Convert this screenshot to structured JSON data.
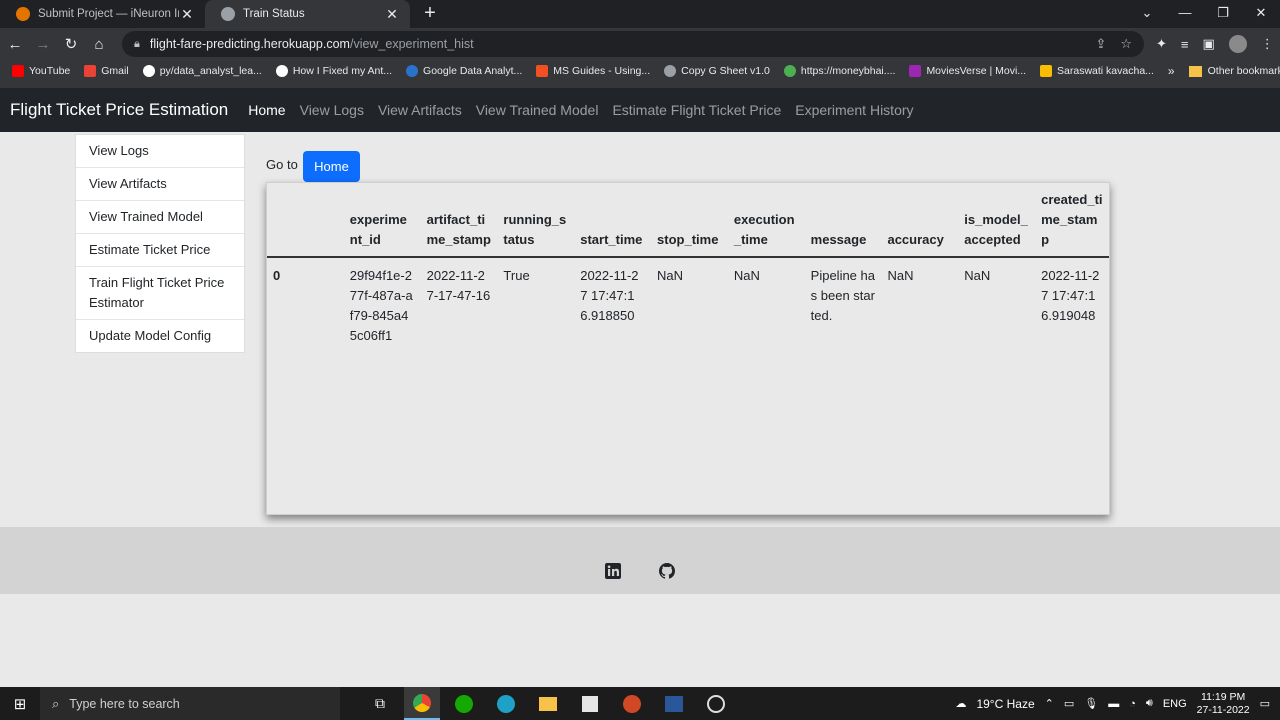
{
  "browser": {
    "tabs": [
      {
        "title": "Submit Project — iNeuron Intern",
        "close": "✕",
        "favicon_color": "#e37400"
      },
      {
        "title": "Train Status",
        "close": "✕",
        "favicon_color": "#9aa0a6"
      }
    ],
    "new_tab": "+",
    "address": {
      "host": "flight-fare-predicting.herokuapp.com",
      "path": "/view_experiment_hist"
    },
    "bookmarks": [
      {
        "label": "YouTube",
        "icon": "youtube-icon",
        "color": "#ff0000"
      },
      {
        "label": "Gmail",
        "icon": "gmail-icon",
        "color": "#ea4335"
      },
      {
        "label": "py/data_analyst_lea...",
        "icon": "github-icon",
        "color": "#ffffff"
      },
      {
        "label": "How I Fixed my Ant...",
        "icon": "medium-icon",
        "color": "#ffffff"
      },
      {
        "label": "Google Data Analyt...",
        "icon": "coursera-icon",
        "color": "#2a73cc"
      },
      {
        "label": "MS Guides - Using...",
        "icon": "ms-icon",
        "color": "#f25022"
      },
      {
        "label": "Copy G Sheet v1.0",
        "icon": "globe-icon",
        "color": "#9aa0a6"
      },
      {
        "label": "https://moneybhai....",
        "icon": "money-icon",
        "color": "#4caf50"
      },
      {
        "label": "MoviesVerse | Movi...",
        "icon": "movies-icon",
        "color": "#9c27b0"
      },
      {
        "label": "Saraswati kavacha...",
        "icon": "drive-icon",
        "color": "#fbbc04"
      }
    ],
    "bookmarks_more": "»",
    "other_bookmarks": "Other bookmarks"
  },
  "navbar": {
    "brand": "Flight Ticket Price Estimation",
    "links": [
      "Home",
      "View Logs",
      "View Artifacts",
      "View Trained Model",
      "Estimate Flight Ticket Price",
      "Experiment History"
    ]
  },
  "sidebar": {
    "items": [
      "View Logs",
      "View Artifacts",
      "View Trained Model",
      "Estimate Ticket Price",
      "Train Flight Ticket Price Estimator",
      "Update Model Config"
    ]
  },
  "goto": {
    "label": "Go to",
    "button": "Home"
  },
  "table": {
    "headers": [
      "",
      "experiment_id",
      "artifact_time_stamp",
      "running_status",
      "start_time",
      "stop_time",
      "execution_time",
      "message",
      "accuracy",
      "is_model_accepted",
      "created_time_stamp"
    ],
    "rows": [
      [
        "0",
        "29f94f1e-277f-487a-af79-845a45c06ff1",
        "2022-11-27-17-47-16",
        "True",
        "2022-11-27 17:47:16.918850",
        "NaN",
        "NaN",
        "Pipeline has been started.",
        "NaN",
        "NaN",
        "2022-11-27 17:47:16.919048"
      ]
    ]
  },
  "taskbar": {
    "search_placeholder": "Type here to search",
    "weather": "19°C  Haze",
    "lang": "ENG",
    "time": "11:19 PM",
    "date": "27-11-2022"
  }
}
